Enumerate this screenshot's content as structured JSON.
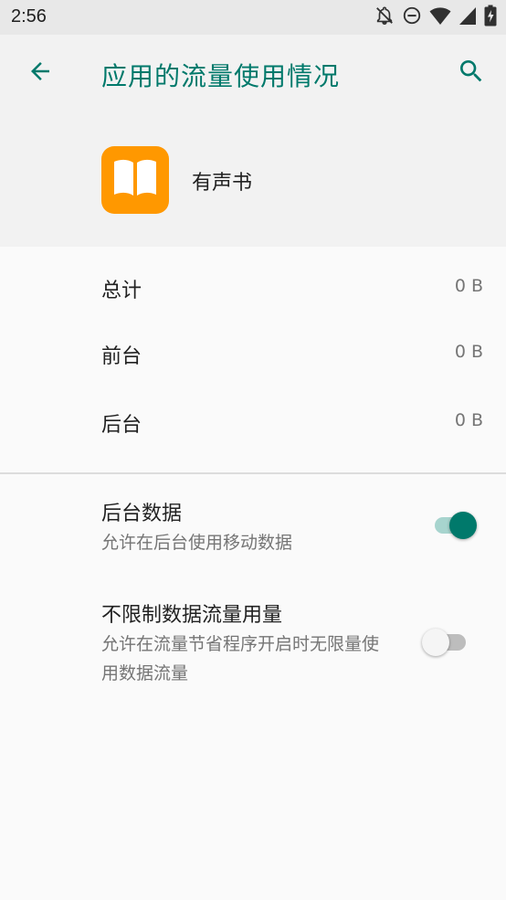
{
  "status_bar": {
    "time": "2:56",
    "icons": [
      "notifications-off-icon",
      "do-not-disturb-icon",
      "wifi-icon",
      "cell-signal-icon",
      "battery-charging-icon"
    ]
  },
  "toolbar": {
    "title": "应用的流量使用情况",
    "back_icon": "arrow-back-icon",
    "search_icon": "search-icon",
    "accent_color": "#00796b"
  },
  "app": {
    "name": "有声书",
    "icon": "book-icon",
    "icon_color": "#ff9800"
  },
  "usage": [
    {
      "label": "总计",
      "value": "0 B"
    },
    {
      "label": "前台",
      "value": "0 B"
    },
    {
      "label": "后台",
      "value": "0 B"
    }
  ],
  "settings": [
    {
      "title": "后台数据",
      "description": "允许在后台使用移动数据",
      "enabled": true
    },
    {
      "title": "不限制数据流量用量",
      "description": "允许在流量节省程序开启时无限量使用数据流量",
      "enabled": false
    }
  ]
}
